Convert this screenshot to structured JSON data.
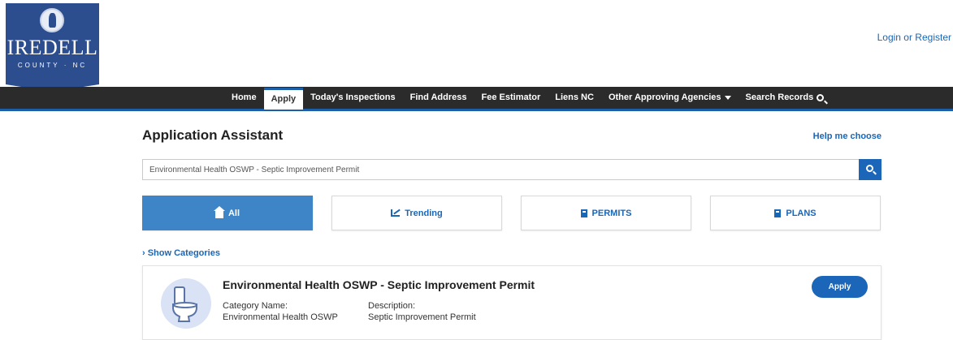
{
  "header": {
    "logo": {
      "name": "IREDELL",
      "sub": "COUNTY · NC"
    },
    "login_link": "Login or Register"
  },
  "nav": {
    "items": [
      {
        "label": "Home"
      },
      {
        "label": "Apply",
        "active": true
      },
      {
        "label": "Today's Inspections"
      },
      {
        "label": "Find Address"
      },
      {
        "label": "Fee Estimator"
      },
      {
        "label": "Liens NC"
      },
      {
        "label": "Other Approving Agencies",
        "icon": "caret-down-icon"
      },
      {
        "label": "Search Records",
        "icon": "search-icon"
      }
    ]
  },
  "main": {
    "title": "Application Assistant",
    "help_link": "Help me choose",
    "search": {
      "value": "Environmental Health OSWP - Septic Improvement Permit"
    },
    "tabs": [
      {
        "label": "All",
        "icon": "home-icon",
        "active": true
      },
      {
        "label": "Trending",
        "icon": "trending-icon"
      },
      {
        "label": "PERMITS",
        "icon": "bookmark-icon"
      },
      {
        "label": "PLANS",
        "icon": "bookmark-icon"
      }
    ],
    "show_categories": "› Show Categories",
    "result": {
      "title": "Environmental Health OSWP - Septic Improvement Permit",
      "icon": "toilet-icon",
      "category_label": "Category Name:",
      "category_value": "Environmental Health OSWP",
      "description_label": "Description:",
      "description_value": "Septic Improvement Permit",
      "apply_label": "Apply"
    }
  },
  "colors": {
    "accent": "#1b66b8",
    "nav_bg": "#2b2b2b",
    "logo_bg": "#2c4d8e",
    "active_tab": "#3d85c6"
  }
}
